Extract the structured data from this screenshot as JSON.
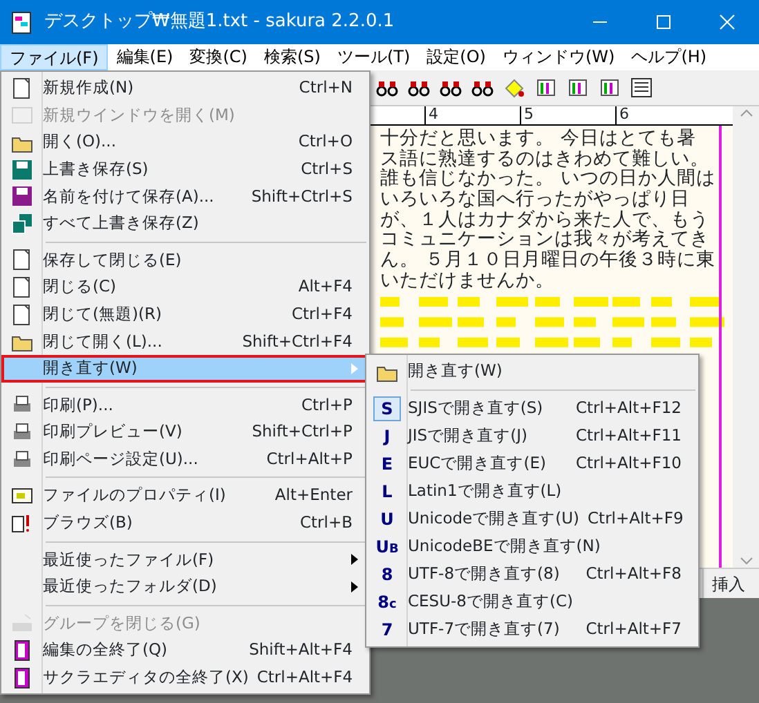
{
  "window": {
    "title": "デスクトップ₩無題1.txt - sakura 2.2.0.1"
  },
  "menubar": [
    {
      "label": "ファイル(F)",
      "selected": true
    },
    {
      "label": "編集(E)",
      "selected": false
    },
    {
      "label": "変換(C)",
      "selected": false
    },
    {
      "label": "検索(S)",
      "selected": false
    },
    {
      "label": "ツール(T)",
      "selected": false
    },
    {
      "label": "設定(O)",
      "selected": false
    },
    {
      "label": "ウィンドウ(W)",
      "selected": false
    },
    {
      "label": "ヘルプ(H)",
      "selected": false
    }
  ],
  "ruler": [
    "4",
    "5",
    "6"
  ],
  "editor_lines": [
    "十分だと思います。 今日はとても暑",
    "ス語に熟達するのはきわめて難しい。",
    "誰も信じなかった。 いつの日か人間は",
    "いろいろな国へ行ったがやっぱり日",
    "が、１人はカナダから来た人で、もう",
    "コミュニケーションは我々が考えてき",
    "ん。 ５月１０日月曜日の午後３時に東",
    "いただけませんか。"
  ],
  "status_bar": {
    "mode": "挿入"
  },
  "file_menu": [
    {
      "kind": "item",
      "label": "新規作成(N)",
      "shortcut": "Ctrl+N",
      "disabled": false,
      "selected": false,
      "submenu": false
    },
    {
      "kind": "item",
      "label": "新規ウインドウを開く(M)",
      "disabled": true,
      "selected": false,
      "submenu": false
    },
    {
      "kind": "item",
      "label": "開く(O)...",
      "shortcut": "Ctrl+O",
      "disabled": false,
      "selected": false,
      "submenu": false
    },
    {
      "kind": "item",
      "label": "上書き保存(S)",
      "shortcut": "Ctrl+S",
      "disabled": false,
      "selected": false,
      "submenu": false
    },
    {
      "kind": "item",
      "label": "名前を付けて保存(A)...",
      "shortcut": "Shift+Ctrl+S",
      "disabled": false,
      "selected": false,
      "submenu": false
    },
    {
      "kind": "item",
      "label": "すべて上書き保存(Z)",
      "disabled": false,
      "selected": false,
      "submenu": false
    },
    {
      "kind": "separator"
    },
    {
      "kind": "item",
      "label": "保存して閉じる(E)",
      "disabled": false,
      "selected": false,
      "submenu": false
    },
    {
      "kind": "item",
      "label": "閉じる(C)",
      "shortcut": "Alt+F4",
      "disabled": false,
      "selected": false,
      "submenu": false
    },
    {
      "kind": "item",
      "label": "閉じて(無題)(R)",
      "shortcut": "Ctrl+F4",
      "disabled": false,
      "selected": false,
      "submenu": false
    },
    {
      "kind": "item",
      "label": "閉じて開く(L)...",
      "shortcut": "Shift+Ctrl+F4",
      "disabled": false,
      "selected": false,
      "submenu": false
    },
    {
      "kind": "item",
      "label": "開き直す(W)",
      "disabled": false,
      "selected": true,
      "submenu": true
    },
    {
      "kind": "separator"
    },
    {
      "kind": "item",
      "label": "印刷(P)...",
      "shortcut": "Ctrl+P",
      "disabled": false,
      "selected": false,
      "submenu": false
    },
    {
      "kind": "item",
      "label": "印刷プレビュー(V)",
      "shortcut": "Shift+Ctrl+P",
      "disabled": false,
      "selected": false,
      "submenu": false
    },
    {
      "kind": "item",
      "label": "印刷ページ設定(U)...",
      "shortcut": "Ctrl+Alt+P",
      "disabled": false,
      "selected": false,
      "submenu": false
    },
    {
      "kind": "separator"
    },
    {
      "kind": "item",
      "label": "ファイルのプロパティ(I)",
      "shortcut": "Alt+Enter",
      "disabled": false,
      "selected": false,
      "submenu": false
    },
    {
      "kind": "item",
      "label": "ブラウズ(B)",
      "shortcut": "Ctrl+B",
      "disabled": false,
      "selected": false,
      "submenu": false
    },
    {
      "kind": "separator"
    },
    {
      "kind": "item",
      "label": "最近使ったファイル(F)",
      "disabled": false,
      "selected": false,
      "submenu": true
    },
    {
      "kind": "item",
      "label": "最近使ったフォルダ(D)",
      "disabled": false,
      "selected": false,
      "submenu": true
    },
    {
      "kind": "separator"
    },
    {
      "kind": "item",
      "label": "グループを閉じる(G)",
      "disabled": true,
      "selected": false,
      "submenu": false
    },
    {
      "kind": "item",
      "label": "編集の全終了(Q)",
      "shortcut": "Shift+Alt+F4",
      "disabled": false,
      "selected": false,
      "submenu": false
    },
    {
      "kind": "item",
      "label": "サクラエディタの全終了(X)",
      "shortcut": "Ctrl+Alt+F4",
      "disabled": false,
      "selected": false,
      "submenu": false
    }
  ],
  "reopen_submenu": [
    {
      "kind": "item",
      "label": "開き直す(W)",
      "selected": false
    },
    {
      "kind": "separator"
    },
    {
      "kind": "item",
      "mark": "S",
      "label": "SJISで開き直す(S)",
      "shortcut": "Ctrl+Alt+F12",
      "selected": true
    },
    {
      "kind": "item",
      "mark": "J",
      "label": "JISで開き直す(J)",
      "shortcut": "Ctrl+Alt+F11",
      "selected": false
    },
    {
      "kind": "item",
      "mark": "E",
      "label": "EUCで開き直す(E)",
      "shortcut": "Ctrl+Alt+F10",
      "selected": false
    },
    {
      "kind": "item",
      "mark": "L",
      "label": "Latin1で開き直す(L)",
      "selected": false
    },
    {
      "kind": "item",
      "mark": "U",
      "label": "Unicodeで開き直す(U)",
      "shortcut": "Ctrl+Alt+F9",
      "selected": false
    },
    {
      "kind": "item",
      "mark": "U$_{B}$",
      "label": "UnicodeBEで開き直す(N)",
      "selected": false
    },
    {
      "kind": "item",
      "mark": "8",
      "label": "UTF-8で開き直す(8)",
      "shortcut": "Ctrl+Alt+F8",
      "selected": false
    },
    {
      "kind": "item",
      "mark": "8$_{c}$",
      "label": "CESU-8で開き直す(C)",
      "selected": false
    },
    {
      "kind": "item",
      "mark": "7",
      "label": "UTF-7で開き直す(7)",
      "shortcut": "Ctrl+Alt+F7",
      "selected": false
    }
  ]
}
